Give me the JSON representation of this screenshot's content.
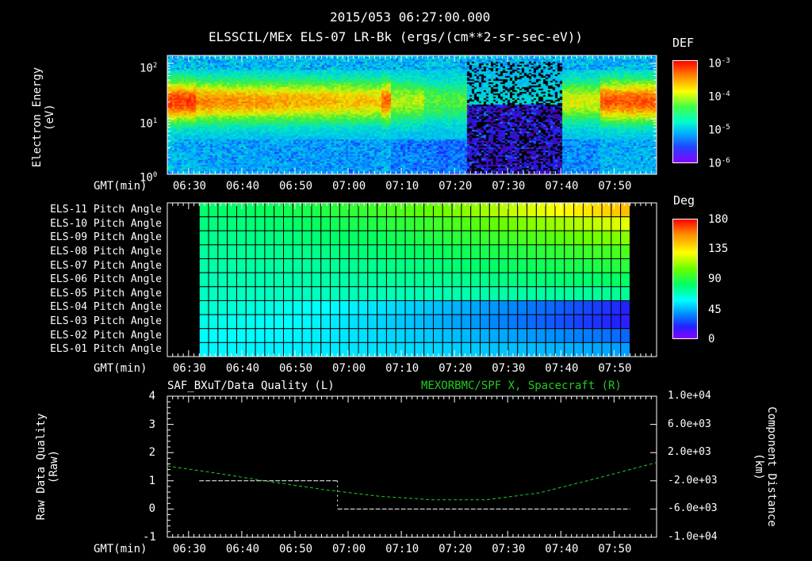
{
  "header": {
    "timestamp": "2015/053 06:27:00.000",
    "title": "ELSSCIL/MEx ELS-07 LR-Bk  (ergs/(cm**2-sr-sec-eV))"
  },
  "panel1": {
    "ylabel_line1": "Electron Energy",
    "ylabel_line2": "(eV)",
    "yticks": [
      "10",
      "10",
      "10"
    ],
    "yexp": [
      "2",
      "1",
      "0"
    ],
    "gmt_label": "GMT(min)",
    "colorbar_title": "DEF",
    "colorbar_base": [
      "10",
      "10",
      "10",
      "10"
    ],
    "colorbar_exp": [
      "-3",
      "-4",
      "-5",
      "-6"
    ]
  },
  "panel2": {
    "rows": [
      "ELS-11 Pitch Angle",
      "ELS-10 Pitch Angle",
      "ELS-09 Pitch Angle",
      "ELS-08 Pitch Angle",
      "ELS-07 Pitch Angle",
      "ELS-06 Pitch Angle",
      "ELS-05 Pitch Angle",
      "ELS-04 Pitch Angle",
      "ELS-03 Pitch Angle",
      "ELS-02 Pitch Angle",
      "ELS-01 Pitch Angle"
    ],
    "gmt_label": "GMT(min)",
    "colorbar_title": "Deg",
    "colorbar_ticks": [
      "180",
      "135",
      "90",
      "45",
      "0"
    ]
  },
  "panel3": {
    "left_title": "SAF_BXuT/Data Quality (L)",
    "right_title": "MEXORBMC/SPF X, Spacecraft (R)",
    "ylabel_line1": "Raw Data Quality",
    "ylabel_line2": "(Raw)",
    "yticks": [
      "4",
      "3",
      "2",
      "1",
      "0",
      "-1"
    ],
    "right_ylabel_line1": "Component Distance",
    "right_ylabel_line2": "(km)",
    "right_yticks": [
      "1.0e+04",
      "6.0e+03",
      "2.0e+03",
      "-2.0e+03",
      "-6.0e+03",
      "-1.0e+04"
    ],
    "gmt_label": "GMT(min)"
  },
  "time_ticks": [
    "06:30",
    "06:40",
    "06:50",
    "07:00",
    "07:10",
    "07:20",
    "07:30",
    "07:40",
    "07:50"
  ],
  "colors": {
    "dq": "#ffffff",
    "spf": "#22cc22"
  },
  "chart_data": [
    {
      "type": "heatmap",
      "title": "ELSSCIL/MEx ELS-07 LR-Bk  (ergs/(cm**2-sr-sec-eV))",
      "xlabel": "GMT(min)",
      "ylabel": "Electron Energy (eV)",
      "yscale": "log",
      "ylim": [
        1,
        150
      ],
      "xlim": [
        "06:26",
        "07:58"
      ],
      "colorbar": {
        "label": "DEF",
        "scale": "log",
        "range": [
          1e-06,
          0.001
        ]
      }
    },
    {
      "type": "heatmap",
      "xlabel": "GMT(min)",
      "rows": [
        "ELS-11",
        "ELS-10",
        "ELS-09",
        "ELS-08",
        "ELS-07",
        "ELS-06",
        "ELS-05",
        "ELS-04",
        "ELS-03",
        "ELS-02",
        "ELS-01"
      ],
      "x": [
        "06:32",
        "07:53"
      ],
      "start_values": [
        80,
        77,
        75,
        73,
        71,
        69,
        67,
        64,
        61,
        58,
        56
      ],
      "end_values": [
        145,
        125,
        110,
        98,
        90,
        82,
        74,
        18,
        16,
        30,
        40
      ],
      "colorbar": {
        "label": "Deg",
        "range": [
          0,
          180
        ]
      }
    },
    {
      "type": "line",
      "xlabel": "GMT(min)",
      "ylabel": "Raw Data Quality (Raw)",
      "ylim": [
        -1,
        4
      ],
      "y2label": "Component Distance (km)",
      "y2lim": [
        -10000,
        10000
      ],
      "series": [
        {
          "name": "SAF_BXuT/Data Quality (L)",
          "axis": "left",
          "x": [
            "06:32",
            "06:58",
            "06:58",
            "07:53"
          ],
          "y": [
            1,
            1,
            0,
            0
          ]
        },
        {
          "name": "MEXORBMC/SPF X, Spacecraft (R)",
          "axis": "right",
          "x": [
            "06:26",
            "06:36",
            "06:46",
            "06:56",
            "07:06",
            "07:16",
            "07:26",
            "07:36",
            "07:46",
            "07:58"
          ],
          "y": [
            100,
            -1000,
            -2200,
            -3300,
            -4200,
            -4700,
            -4700,
            -3700,
            -1800,
            600
          ]
        }
      ]
    }
  ]
}
